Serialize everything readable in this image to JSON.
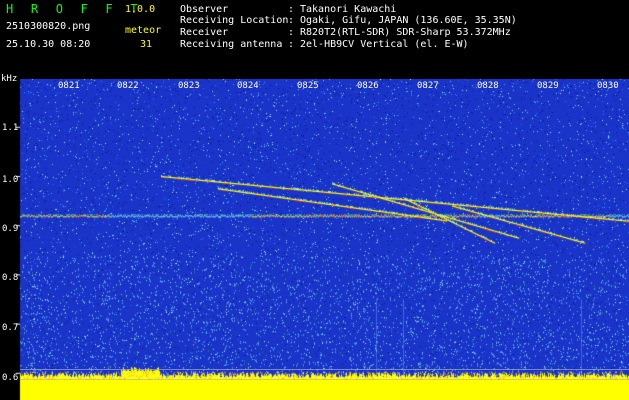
{
  "app": {
    "title": "H R O F F T",
    "version": "1.0.0"
  },
  "capture": {
    "filename": "2510300820.png",
    "timestamp": "25.10.30 08:20",
    "meteor_label": "meteor",
    "meteor_count": "31"
  },
  "info_rows": [
    {
      "label": "Observer",
      "value": "Takanori Kawachi"
    },
    {
      "label": "Receiving Location",
      "value": "Ogaki, Gifu, JAPAN (136.60E, 35.35N)"
    },
    {
      "label": "Receiver",
      "value": "R820T2(RTL-SDR) SDR-Sharp 53.372MHz"
    },
    {
      "label": "Receiving antenna",
      "value": "2el-HB9CV Vertical (el. E-W)"
    }
  ],
  "chart_data": {
    "type": "heatmap",
    "title": "",
    "ylabel": "kHz",
    "x_ticks": [
      "0821",
      "0822",
      "0823",
      "0824",
      "0825",
      "0826",
      "0827",
      "0828",
      "0829",
      "0830"
    ],
    "y_ticks": [
      "1.1",
      "1.0",
      "0.9",
      "0.8",
      "0.7",
      "0.6"
    ],
    "ylim": [
      0.57,
      1.18
    ],
    "carrier_khz": 0.92,
    "meteor_traces": [
      {
        "start_min": 22.55,
        "end_min": 30.7,
        "start_khz": 1.0,
        "end_khz": 0.905
      },
      {
        "start_min": 23.5,
        "end_min": 27.3,
        "start_khz": 0.975,
        "end_khz": 0.91
      },
      {
        "start_min": 25.4,
        "end_min": 28.5,
        "start_khz": 0.985,
        "end_khz": 0.875
      },
      {
        "start_min": 26.6,
        "end_min": 28.1,
        "start_khz": 0.955,
        "end_khz": 0.865
      },
      {
        "start_min": 27.4,
        "end_min": 29.6,
        "start_khz": 0.94,
        "end_khz": 0.865
      }
    ],
    "colors": {
      "background": "#1a33c8",
      "noise_high": "#40e0ff",
      "signal": "#ffff00",
      "peak": "#ff3000",
      "floor": "#ffff00"
    }
  }
}
